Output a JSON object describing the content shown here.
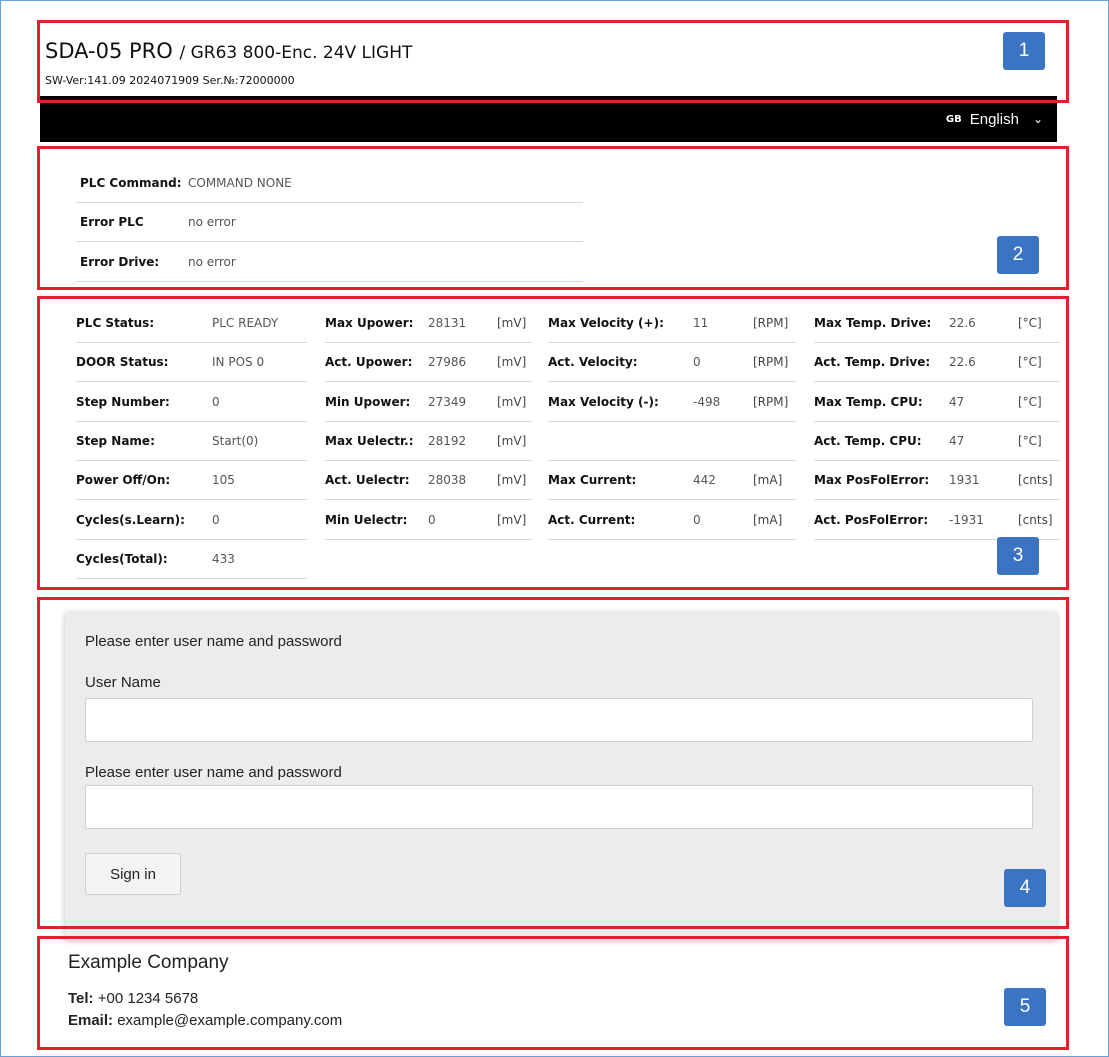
{
  "header": {
    "model": "SDA-05 PRO",
    "variant": "/ GR63 800-Enc. 24V LIGHT",
    "sw_version": "SW-Ver:141.09 2024071909 Ser.№:72000000"
  },
  "language": {
    "flag": "GB",
    "label": "English",
    "icon": "chevron-down-icon"
  },
  "plc_panel": [
    {
      "label": "PLC Command:",
      "value": "COMMAND NONE"
    },
    {
      "label": "Error PLC",
      "value": "no error"
    },
    {
      "label": "Error Drive:",
      "value": "no error"
    }
  ],
  "status": {
    "col1": [
      {
        "label": "PLC Status:",
        "value": "PLC READY"
      },
      {
        "label": "DOOR Status:",
        "value": "IN POS 0"
      },
      {
        "label": "Step Number:",
        "value": "0"
      },
      {
        "label": "Step Name:",
        "value": "Start(0)"
      },
      {
        "label": "Power Off/On:",
        "value": "105"
      },
      {
        "label": "Cycles(s.Learn):",
        "value": "0"
      },
      {
        "label": "Cycles(Total):",
        "value": "433"
      }
    ],
    "col2": [
      {
        "label": "Max Upower:",
        "value": "28131",
        "unit": "[mV]"
      },
      {
        "label": "Act. Upower:",
        "value": "27986",
        "unit": "[mV]"
      },
      {
        "label": "Min Upower:",
        "value": "27349",
        "unit": "[mV]"
      },
      {
        "label": "Max Uelectr.:",
        "value": "28192",
        "unit": "[mV]"
      },
      {
        "label": "Act. Uelectr:",
        "value": "28038",
        "unit": "[mV]"
      },
      {
        "label": "Min Uelectr:",
        "value": "0",
        "unit": "[mV]"
      }
    ],
    "col3": [
      {
        "label": "Max Velocity (+):",
        "value": "11",
        "unit": "[RPM]"
      },
      {
        "label": "Act. Velocity:",
        "value": "0",
        "unit": "[RPM]"
      },
      {
        "label": "Max Velocity (-):",
        "value": "-498",
        "unit": "[RPM]"
      },
      {
        "label": "",
        "value": "",
        "unit": ""
      },
      {
        "label": "Max Current:",
        "value": "442",
        "unit": "[mA]"
      },
      {
        "label": "Act. Current:",
        "value": "0",
        "unit": "[mA]"
      }
    ],
    "col4": [
      {
        "label": "Max Temp. Drive:",
        "value": "22.6",
        "unit": "[°C]"
      },
      {
        "label": "Act. Temp. Drive:",
        "value": "22.6",
        "unit": "[°C]"
      },
      {
        "label": "Max Temp. CPU:",
        "value": "47",
        "unit": "[°C]"
      },
      {
        "label": "Act. Temp. CPU:",
        "value": "47",
        "unit": "[°C]"
      },
      {
        "label": "Max PosFolError:",
        "value": "1931",
        "unit": "[cnts]"
      },
      {
        "label": "Act. PosFolError:",
        "value": "-1931",
        "unit": "[cnts]"
      }
    ]
  },
  "login": {
    "prompt": "Please enter user name and password",
    "username_label": "User Name",
    "password_label": "Please enter user name and password",
    "username_value": "",
    "password_value": "",
    "signin_label": "Sign in"
  },
  "company": {
    "name": "Example Company",
    "tel_label": "Tel:",
    "tel_value": "+00 1234 5678",
    "email_label": "Email:",
    "email_value": "example@example.company.com"
  },
  "badges": [
    "1",
    "2",
    "3",
    "4",
    "5"
  ],
  "colors": {
    "annotation_border": "#e0222a",
    "badge": "#3b74c2",
    "bar": "#000000"
  }
}
